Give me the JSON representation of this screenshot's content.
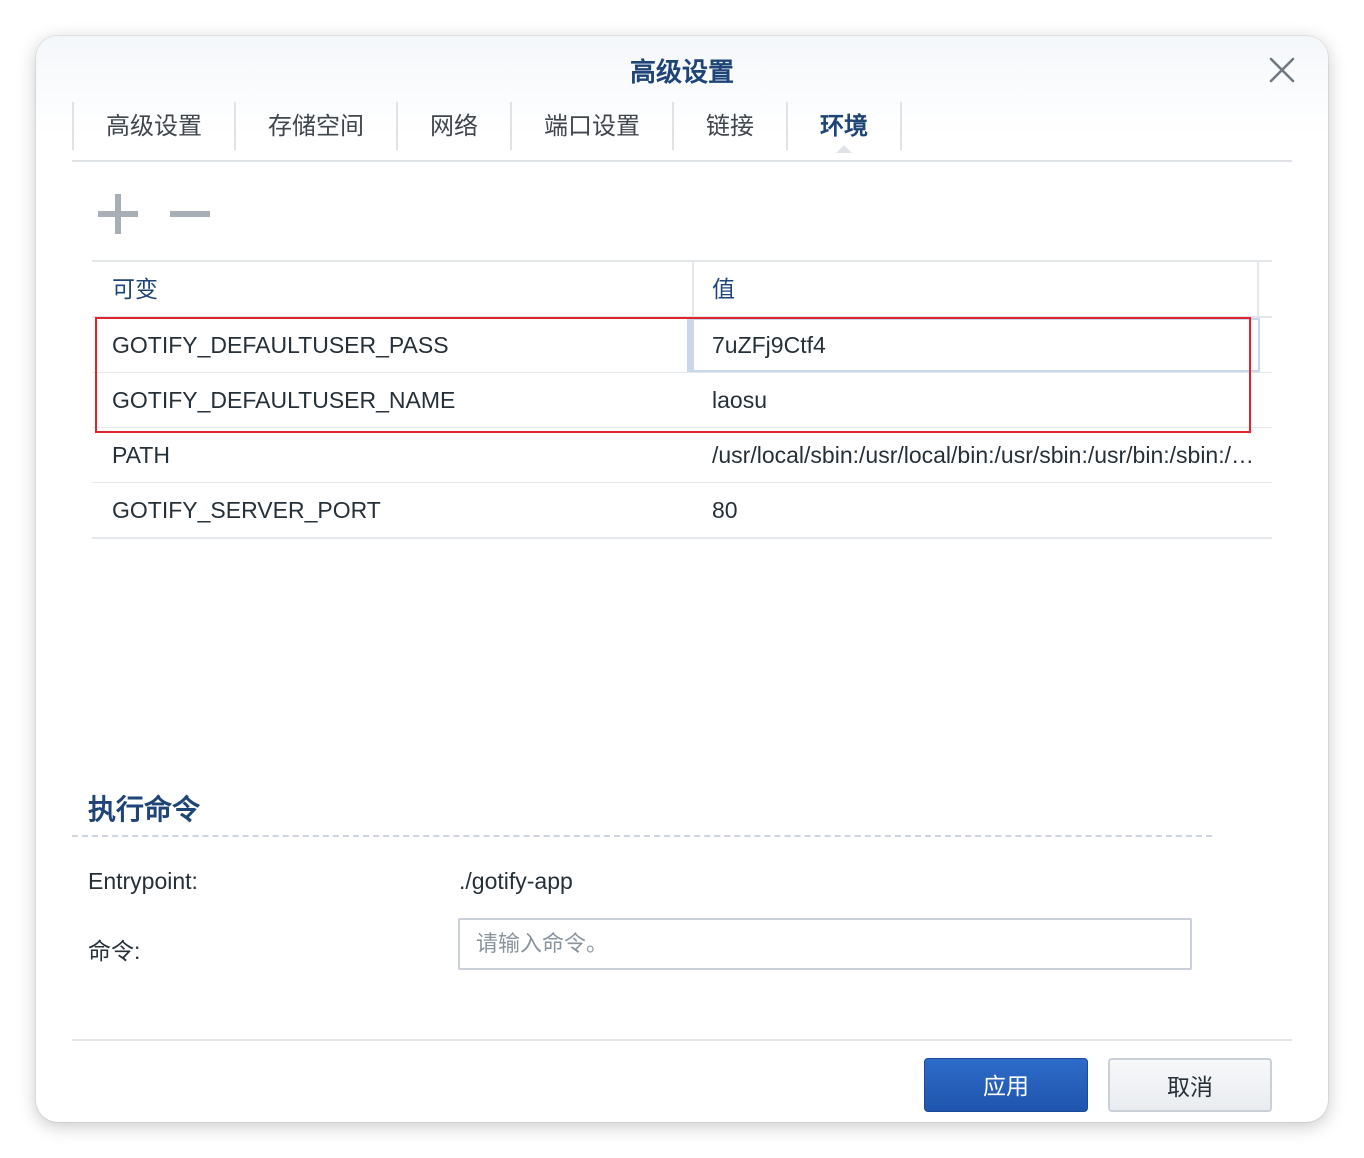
{
  "dialog": {
    "title": "高级设置",
    "close_icon": "close-icon"
  },
  "tabs": [
    {
      "label": "高级设置",
      "active": false
    },
    {
      "label": "存储空间",
      "active": false
    },
    {
      "label": "网络",
      "active": false
    },
    {
      "label": "端口设置",
      "active": false
    },
    {
      "label": "链接",
      "active": false
    },
    {
      "label": "环境",
      "active": true
    }
  ],
  "toolbar": {
    "add_icon": "plus-icon",
    "remove_icon": "minus-icon"
  },
  "env_table": {
    "headers": [
      "可变",
      "值"
    ],
    "rows": [
      {
        "variable": "GOTIFY_DEFAULTUSER_PASS",
        "value": "7uZFj9Ctf4"
      },
      {
        "variable": "GOTIFY_DEFAULTUSER_NAME",
        "value": "laosu"
      },
      {
        "variable": "PATH",
        "value": "/usr/local/sbin:/usr/local/bin:/usr/sbin:/usr/bin:/sbin:/bin"
      },
      {
        "variable": "GOTIFY_SERVER_PORT",
        "value": "80"
      }
    ],
    "highlight_color": "#e0242b"
  },
  "execution": {
    "section_title": "执行命令",
    "entrypoint_label": "Entrypoint:",
    "entrypoint_value": "./gotify-app",
    "command_label": "命令:",
    "command_value": "",
    "command_placeholder": "请输入命令。"
  },
  "footer": {
    "apply_label": "应用",
    "cancel_label": "取消"
  },
  "colors": {
    "accent": "#1e4478",
    "primary_button": "#2461bd"
  }
}
